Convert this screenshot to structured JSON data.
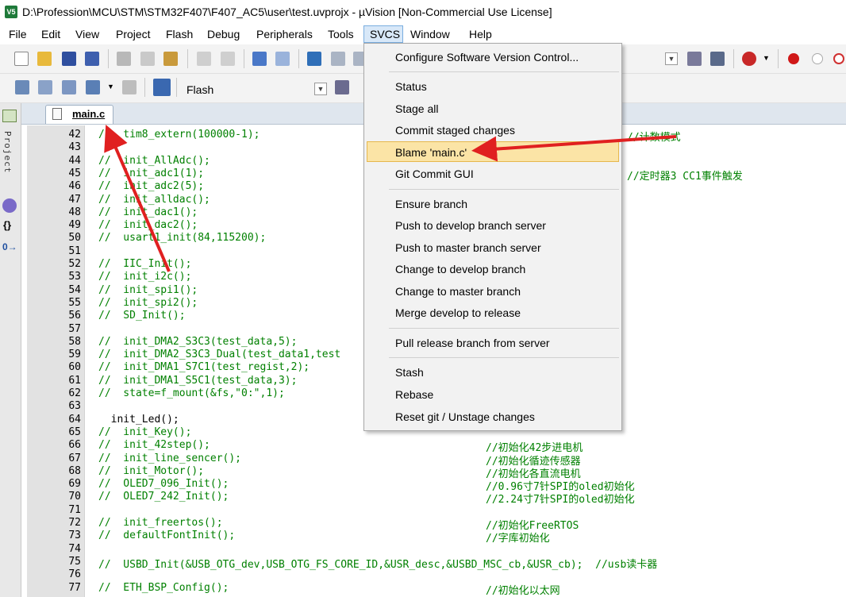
{
  "window": {
    "title": "D:\\Profession\\MCU\\STM\\STM32F407\\F407_AC5\\user\\test.uvprojx - µVision  [Non-Commercial Use License]",
    "app_icon_text": "V5"
  },
  "menubar": [
    "File",
    "Edit",
    "View",
    "Project",
    "Flash",
    "Debug",
    "Peripherals",
    "Tools",
    "SVCS",
    "Window",
    "Help"
  ],
  "toolbar": {
    "target": "Flash"
  },
  "left_panel": {
    "project_tab": "Project",
    "braces_icon": "{}",
    "func_icon": "0→"
  },
  "editor": {
    "tab": "main.c",
    "lines": [
      {
        "n": "42",
        "t": "//  tim8_extern(100000-1);",
        "c": "//计数模式"
      },
      {
        "n": "43",
        "t": "",
        "c": ""
      },
      {
        "n": "44",
        "t": "//  init_AllAdc();",
        "c": ""
      },
      {
        "n": "45",
        "t": "//  init_adc1(1);",
        "c": "//定时器3 CC1事件触发"
      },
      {
        "n": "46",
        "t": "//  init_adc2(5);",
        "c": ""
      },
      {
        "n": "47",
        "t": "//  init_alldac();",
        "c": ""
      },
      {
        "n": "48",
        "t": "//  init_dac1();",
        "c": ""
      },
      {
        "n": "49",
        "t": "//  init_dac2();",
        "c": ""
      },
      {
        "n": "50",
        "t": "//  usart1_init(84,115200);",
        "c": ""
      },
      {
        "n": "51",
        "t": "",
        "c": ""
      },
      {
        "n": "52",
        "t": "//  IIC_Init();",
        "c": ""
      },
      {
        "n": "53",
        "t": "//  init_i2c();",
        "c": ""
      },
      {
        "n": "54",
        "t": "//  init_spi1();",
        "c": ""
      },
      {
        "n": "55",
        "t": "//  init_spi2();",
        "c": ""
      },
      {
        "n": "56",
        "t": "//  SD_Init();",
        "c": ""
      },
      {
        "n": "57",
        "t": "",
        "c": ""
      },
      {
        "n": "58",
        "t": "//  init_DMA2_S3C3(test_data,5);",
        "c": ""
      },
      {
        "n": "59",
        "t": "//  init_DMA2_S3C3_Dual(test_data1,test",
        "c": ""
      },
      {
        "n": "60",
        "t": "//  init_DMA1_S7C1(test_regist,2);",
        "c": ""
      },
      {
        "n": "61",
        "t": "//  init_DMA1_S5C1(test_data,3);",
        "c": ""
      },
      {
        "n": "62",
        "t": "//  state=f_mount(&fs,\"0:\",1);",
        "c": ""
      },
      {
        "n": "63",
        "t": "",
        "c": ""
      },
      {
        "n": "64",
        "t": "  init_Led();",
        "c": ""
      },
      {
        "n": "65",
        "t": "//  init_Key();",
        "c": ""
      },
      {
        "n": "66",
        "t": "//  init_42step();",
        "c": "//初始化42步进电机"
      },
      {
        "n": "67",
        "t": "//  init_line_sencer();",
        "c": "//初始化循迹传感器"
      },
      {
        "n": "68",
        "t": "//  init_Motor();",
        "c": "//初始化各直流电机"
      },
      {
        "n": "69",
        "t": "//  OLED7_096_Init();",
        "c": "//0.96寸7针SPI的oled初始化"
      },
      {
        "n": "70",
        "t": "//  OLED7_242_Init();",
        "c": "//2.24寸7针SPI的oled初始化"
      },
      {
        "n": "71",
        "t": "",
        "c": ""
      },
      {
        "n": "72",
        "t": "//  init_freertos();",
        "c": "//初始化FreeRTOS"
      },
      {
        "n": "73",
        "t": "//  defaultFontInit();",
        "c": "//字库初始化"
      },
      {
        "n": "74",
        "t": "",
        "c": ""
      },
      {
        "n": "75",
        "t": "//  USBD_Init(&USB_OTG_dev,USB_OTG_FS_CORE_ID,&USR_desc,&USBD_MSC_cb,&USR_cb);  //usb读卡器",
        "c": ""
      },
      {
        "n": "76",
        "t": "",
        "c": ""
      },
      {
        "n": "77",
        "t": "//  ETH_BSP_Config();",
        "c": "//初始化以太网"
      }
    ]
  },
  "svcs_menu": {
    "items": [
      "Configure Software Version Control...",
      "Status",
      "Stage all",
      "Commit staged changes",
      "Blame 'main.c'",
      "Git Commit GUI",
      "Ensure branch",
      "Push to develop branch server",
      "Push to master branch server",
      "Change to develop branch",
      "Change to master branch",
      "Merge develop to release",
      "Pull release branch  from server",
      "Stash",
      "Rebase",
      "Reset git / Unstage changes"
    ],
    "highlighted": "Blame 'main.c'"
  },
  "colors": {
    "comment": "#008000",
    "highlight": "#fbe4a6",
    "arrow": "#e02020"
  }
}
